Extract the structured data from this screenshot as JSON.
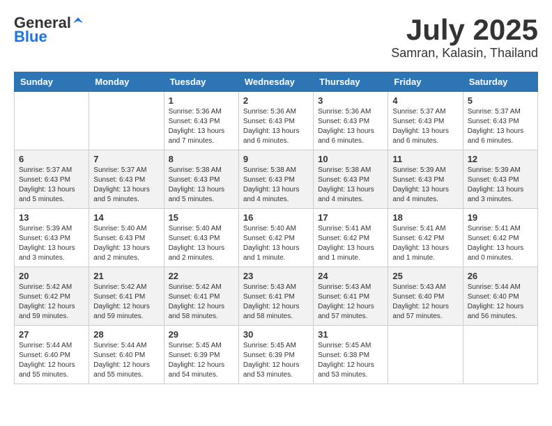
{
  "logo": {
    "general": "General",
    "blue": "Blue"
  },
  "title": "July 2025",
  "subtitle": "Samran, Kalasin, Thailand",
  "headers": [
    "Sunday",
    "Monday",
    "Tuesday",
    "Wednesday",
    "Thursday",
    "Friday",
    "Saturday"
  ],
  "weeks": [
    [
      {
        "day": "",
        "info": ""
      },
      {
        "day": "",
        "info": ""
      },
      {
        "day": "1",
        "info": "Sunrise: 5:36 AM\nSunset: 6:43 PM\nDaylight: 13 hours\nand 7 minutes."
      },
      {
        "day": "2",
        "info": "Sunrise: 5:36 AM\nSunset: 6:43 PM\nDaylight: 13 hours\nand 6 minutes."
      },
      {
        "day": "3",
        "info": "Sunrise: 5:36 AM\nSunset: 6:43 PM\nDaylight: 13 hours\nand 6 minutes."
      },
      {
        "day": "4",
        "info": "Sunrise: 5:37 AM\nSunset: 6:43 PM\nDaylight: 13 hours\nand 6 minutes."
      },
      {
        "day": "5",
        "info": "Sunrise: 5:37 AM\nSunset: 6:43 PM\nDaylight: 13 hours\nand 6 minutes."
      }
    ],
    [
      {
        "day": "6",
        "info": "Sunrise: 5:37 AM\nSunset: 6:43 PM\nDaylight: 13 hours\nand 5 minutes."
      },
      {
        "day": "7",
        "info": "Sunrise: 5:37 AM\nSunset: 6:43 PM\nDaylight: 13 hours\nand 5 minutes."
      },
      {
        "day": "8",
        "info": "Sunrise: 5:38 AM\nSunset: 6:43 PM\nDaylight: 13 hours\nand 5 minutes."
      },
      {
        "day": "9",
        "info": "Sunrise: 5:38 AM\nSunset: 6:43 PM\nDaylight: 13 hours\nand 4 minutes."
      },
      {
        "day": "10",
        "info": "Sunrise: 5:38 AM\nSunset: 6:43 PM\nDaylight: 13 hours\nand 4 minutes."
      },
      {
        "day": "11",
        "info": "Sunrise: 5:39 AM\nSunset: 6:43 PM\nDaylight: 13 hours\nand 4 minutes."
      },
      {
        "day": "12",
        "info": "Sunrise: 5:39 AM\nSunset: 6:43 PM\nDaylight: 13 hours\nand 3 minutes."
      }
    ],
    [
      {
        "day": "13",
        "info": "Sunrise: 5:39 AM\nSunset: 6:43 PM\nDaylight: 13 hours\nand 3 minutes."
      },
      {
        "day": "14",
        "info": "Sunrise: 5:40 AM\nSunset: 6:43 PM\nDaylight: 13 hours\nand 2 minutes."
      },
      {
        "day": "15",
        "info": "Sunrise: 5:40 AM\nSunset: 6:43 PM\nDaylight: 13 hours\nand 2 minutes."
      },
      {
        "day": "16",
        "info": "Sunrise: 5:40 AM\nSunset: 6:42 PM\nDaylight: 13 hours\nand 1 minute."
      },
      {
        "day": "17",
        "info": "Sunrise: 5:41 AM\nSunset: 6:42 PM\nDaylight: 13 hours\nand 1 minute."
      },
      {
        "day": "18",
        "info": "Sunrise: 5:41 AM\nSunset: 6:42 PM\nDaylight: 13 hours\nand 1 minute."
      },
      {
        "day": "19",
        "info": "Sunrise: 5:41 AM\nSunset: 6:42 PM\nDaylight: 13 hours\nand 0 minutes."
      }
    ],
    [
      {
        "day": "20",
        "info": "Sunrise: 5:42 AM\nSunset: 6:42 PM\nDaylight: 12 hours\nand 59 minutes."
      },
      {
        "day": "21",
        "info": "Sunrise: 5:42 AM\nSunset: 6:41 PM\nDaylight: 12 hours\nand 59 minutes."
      },
      {
        "day": "22",
        "info": "Sunrise: 5:42 AM\nSunset: 6:41 PM\nDaylight: 12 hours\nand 58 minutes."
      },
      {
        "day": "23",
        "info": "Sunrise: 5:43 AM\nSunset: 6:41 PM\nDaylight: 12 hours\nand 58 minutes."
      },
      {
        "day": "24",
        "info": "Sunrise: 5:43 AM\nSunset: 6:41 PM\nDaylight: 12 hours\nand 57 minutes."
      },
      {
        "day": "25",
        "info": "Sunrise: 5:43 AM\nSunset: 6:40 PM\nDaylight: 12 hours\nand 57 minutes."
      },
      {
        "day": "26",
        "info": "Sunrise: 5:44 AM\nSunset: 6:40 PM\nDaylight: 12 hours\nand 56 minutes."
      }
    ],
    [
      {
        "day": "27",
        "info": "Sunrise: 5:44 AM\nSunset: 6:40 PM\nDaylight: 12 hours\nand 55 minutes."
      },
      {
        "day": "28",
        "info": "Sunrise: 5:44 AM\nSunset: 6:40 PM\nDaylight: 12 hours\nand 55 minutes."
      },
      {
        "day": "29",
        "info": "Sunrise: 5:45 AM\nSunset: 6:39 PM\nDaylight: 12 hours\nand 54 minutes."
      },
      {
        "day": "30",
        "info": "Sunrise: 5:45 AM\nSunset: 6:39 PM\nDaylight: 12 hours\nand 53 minutes."
      },
      {
        "day": "31",
        "info": "Sunrise: 5:45 AM\nSunset: 6:38 PM\nDaylight: 12 hours\nand 53 minutes."
      },
      {
        "day": "",
        "info": ""
      },
      {
        "day": "",
        "info": ""
      }
    ]
  ]
}
